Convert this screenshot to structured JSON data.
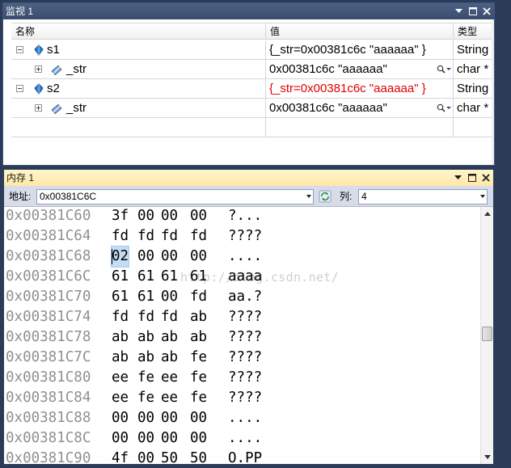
{
  "watch": {
    "title": "监视 1",
    "columns": {
      "name": "名称",
      "value": "值",
      "type": "类型"
    },
    "rows": [
      {
        "name": "s1",
        "value": "{_str=0x00381c6c \"aaaaaa\" }",
        "type": "String",
        "expanded": true
      },
      {
        "name": "_str",
        "value": "0x00381c6c \"aaaaaa\"",
        "type": "char *",
        "expanded": false
      },
      {
        "name": "s2",
        "value": "{_str=0x00381c6c \"aaaaaa\" }",
        "type": "String",
        "expanded": true,
        "changed": true
      },
      {
        "name": "_str",
        "value": "0x00381c6c \"aaaaaa\"",
        "type": "char *",
        "expanded": false
      }
    ]
  },
  "memory": {
    "title": "内存 1",
    "address_label": "地址:",
    "address_value": "0x00381C6C",
    "columns_label": "列:",
    "columns_value": "4",
    "rows": [
      {
        "addr": "0x00381C60",
        "bytes": [
          "3f",
          "00",
          "00",
          "00"
        ],
        "ascii": "?..."
      },
      {
        "addr": "0x00381C64",
        "bytes": [
          "fd",
          "fd",
          "fd",
          "fd"
        ],
        "ascii": "????"
      },
      {
        "addr": "0x00381C68",
        "bytes": [
          "02",
          "00",
          "00",
          "00"
        ],
        "ascii": "...."
      },
      {
        "addr": "0x00381C6C",
        "bytes": [
          "61",
          "61",
          "61",
          "61"
        ],
        "ascii": "aaaa"
      },
      {
        "addr": "0x00381C70",
        "bytes": [
          "61",
          "61",
          "00",
          "fd"
        ],
        "ascii": "aa.?"
      },
      {
        "addr": "0x00381C74",
        "bytes": [
          "fd",
          "fd",
          "fd",
          "ab"
        ],
        "ascii": "????"
      },
      {
        "addr": "0x00381C78",
        "bytes": [
          "ab",
          "ab",
          "ab",
          "ab"
        ],
        "ascii": "????"
      },
      {
        "addr": "0x00381C7C",
        "bytes": [
          "ab",
          "ab",
          "ab",
          "fe"
        ],
        "ascii": "????"
      },
      {
        "addr": "0x00381C80",
        "bytes": [
          "ee",
          "fe",
          "ee",
          "fe"
        ],
        "ascii": "????"
      },
      {
        "addr": "0x00381C84",
        "bytes": [
          "ee",
          "fe",
          "ee",
          "fe"
        ],
        "ascii": "????"
      },
      {
        "addr": "0x00381C88",
        "bytes": [
          "00",
          "00",
          "00",
          "00"
        ],
        "ascii": "...."
      },
      {
        "addr": "0x00381C8C",
        "bytes": [
          "00",
          "00",
          "00",
          "00"
        ],
        "ascii": "...."
      },
      {
        "addr": "0x00381C90",
        "bytes": [
          "4f",
          "00",
          "50",
          "50"
        ],
        "ascii": "O.PP"
      }
    ],
    "selected_row": 2,
    "selected_byte": 0
  },
  "watermark": "http://blog.csdn.net/",
  "colors": {
    "title_inactive": "#3a4c6c",
    "title_active": "#ffe8a6",
    "changed_value": "#e00000",
    "address": "#909090",
    "selection": "#c5dcf5"
  },
  "icons": [
    "dropdown-arrow-icon",
    "restore-icon",
    "close-icon",
    "collapse-icon",
    "expand-icon",
    "field-icon",
    "magnifier-icon",
    "refresh-icon"
  ]
}
